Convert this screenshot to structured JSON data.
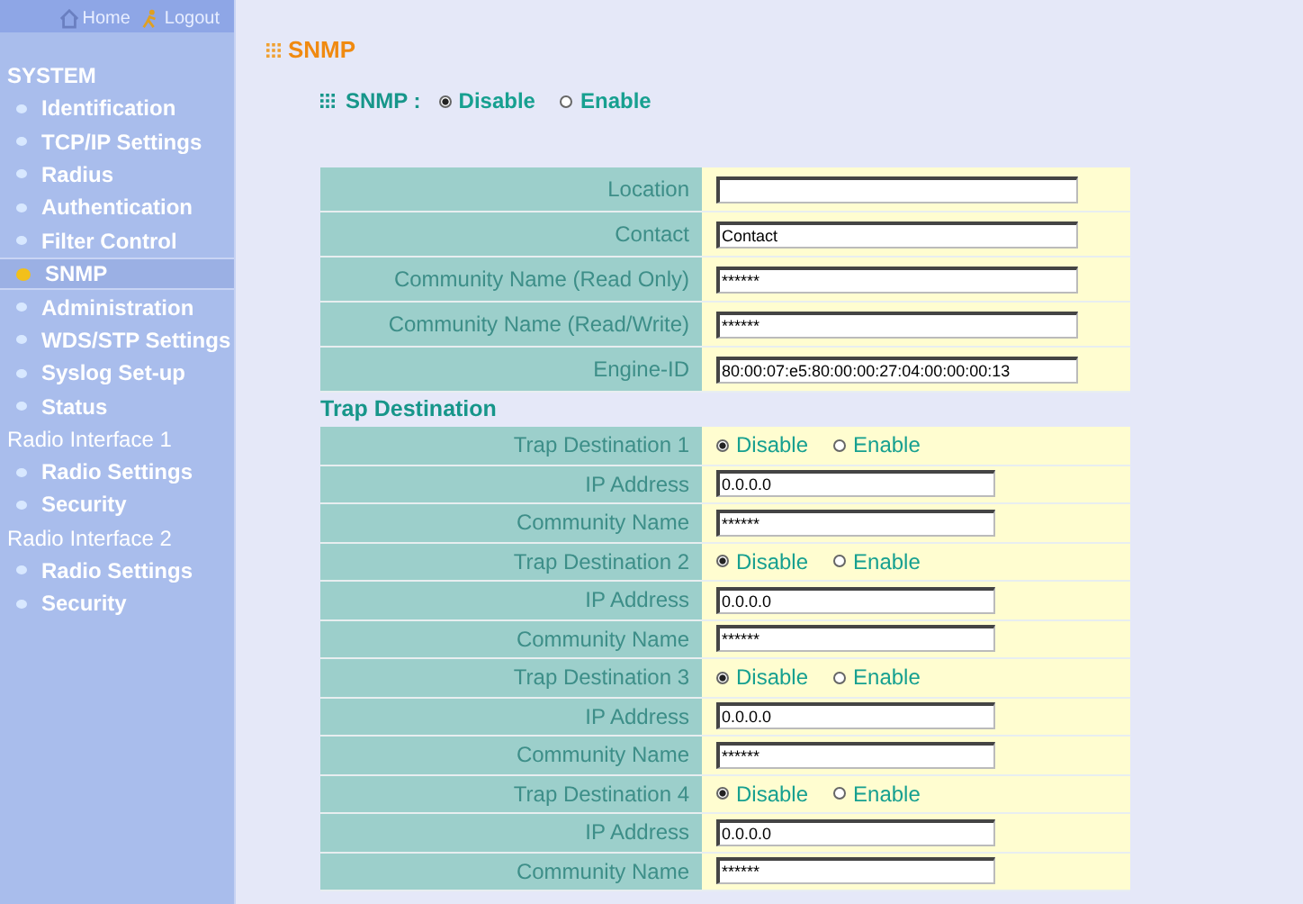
{
  "top_links": [
    {
      "label": "Home"
    },
    {
      "label": "Logout"
    }
  ],
  "sidebar": [
    {
      "title": "SYSTEM",
      "items": [
        {
          "label": "Identification",
          "selected": false
        },
        {
          "label": "TCP/IP Settings",
          "selected": false
        },
        {
          "label": "Radius",
          "selected": false
        },
        {
          "label": "Authentication",
          "selected": false
        },
        {
          "label": "Filter Control",
          "selected": false
        },
        {
          "label": "SNMP",
          "selected": true
        },
        {
          "label": "Administration",
          "selected": false
        },
        {
          "label": "WDS/STP Settings",
          "selected": false
        },
        {
          "label": "Syslog Set-up",
          "selected": false
        },
        {
          "label": "Status",
          "selected": false
        }
      ]
    },
    {
      "title": "Radio Interface 1",
      "items": [
        {
          "label": "Radio Settings",
          "selected": false
        },
        {
          "label": "Security",
          "selected": false
        }
      ]
    },
    {
      "title": "Radio Interface 2",
      "items": [
        {
          "label": "Radio Settings",
          "selected": false
        },
        {
          "label": "Security",
          "selected": false
        }
      ]
    }
  ],
  "page_title": "SNMP",
  "snmp": {
    "label": "SNMP :",
    "options": [
      {
        "label": "Disable",
        "selected": true
      },
      {
        "label": "Enable",
        "selected": false
      }
    ]
  },
  "fields": [
    {
      "label": "Location"
    },
    {
      "label": "Contact",
      "value": "Contact"
    },
    {
      "label": "Community Name (Read Only)",
      "value": "******"
    },
    {
      "label": "Community Name (Read/Write)",
      "value": "******"
    },
    {
      "label": "Engine-ID",
      "value": "80:00:07:e5:80:00:00:27:04:00:00:00:13"
    }
  ],
  "trap_heading": "Trap Destination",
  "traps": [
    {
      "label": "Trap Destination 1",
      "options": [
        {
          "label": "Disable",
          "selected": true
        },
        {
          "label": "Enable",
          "selected": false
        }
      ],
      "ip_label": "IP Address",
      "ip": "0.0.0.0",
      "community_label": "Community Name",
      "community": "******"
    },
    {
      "label": "Trap Destination 2",
      "options": [
        {
          "label": "Disable",
          "selected": true
        },
        {
          "label": "Enable",
          "selected": false
        }
      ],
      "ip_label": "IP Address",
      "ip": "0.0.0.0",
      "community_label": "Community Name",
      "community": "******"
    },
    {
      "label": "Trap Destination 3",
      "options": [
        {
          "label": "Disable",
          "selected": true
        },
        {
          "label": "Enable",
          "selected": false
        }
      ],
      "ip_label": "IP Address",
      "ip": "0.0.0.0",
      "community_label": "Community Name",
      "community": "******"
    },
    {
      "label": "Trap Destination 4",
      "options": [
        {
          "label": "Disable",
          "selected": true
        },
        {
          "label": "Enable",
          "selected": false
        }
      ],
      "ip_label": "IP Address",
      "ip": "0.0.0.0",
      "community_label": "Community Name",
      "community": "******"
    }
  ]
}
